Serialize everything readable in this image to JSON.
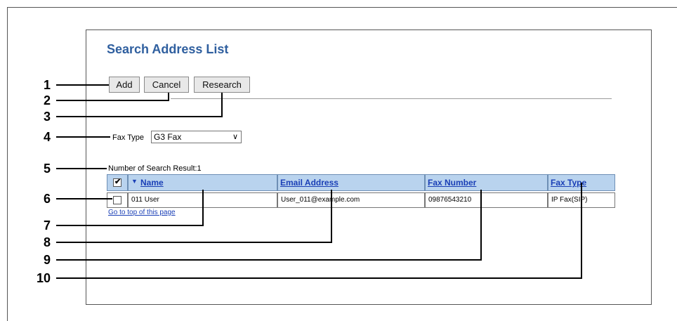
{
  "title": "Search Address List",
  "buttons": {
    "add": "Add",
    "cancel": "Cancel",
    "research": "Research"
  },
  "fax_type": {
    "label": "Fax Type",
    "selected": "G3 Fax"
  },
  "result": {
    "label": "Number of Search Result:1"
  },
  "table": {
    "headers": {
      "name": "Name",
      "email": "Email Address",
      "fax_number": "Fax Number",
      "fax_type": "Fax Type"
    },
    "rows": [
      {
        "name": "011 User",
        "email": "User_011@example.com",
        "fax_number": "09876543210",
        "fax_type": "IP Fax(SIP)"
      }
    ]
  },
  "go_top": "Go to top of this page",
  "callouts": [
    "1",
    "2",
    "3",
    "4",
    "5",
    "6",
    "7",
    "8",
    "9",
    "10"
  ],
  "icons": {
    "sort": "sort-desc-icon",
    "chevron": "chevron-down-icon",
    "checkbox": "checkbox-icon"
  },
  "colors": {
    "title": "#2f5f9f",
    "header_bg": "#b9d3ee",
    "link": "#1a3fb6"
  }
}
